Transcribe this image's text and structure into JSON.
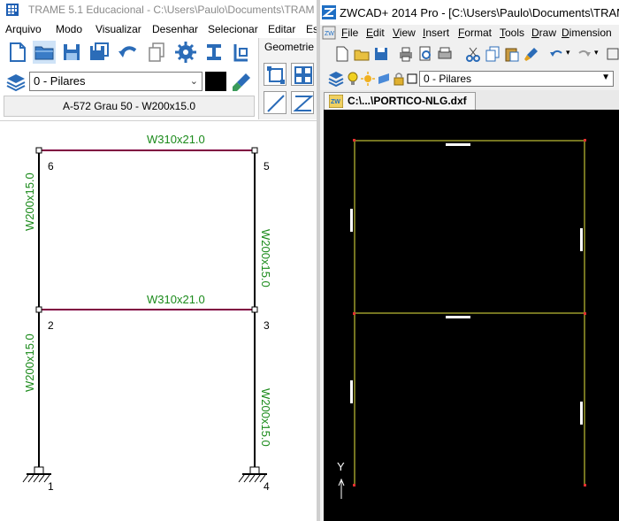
{
  "left_window": {
    "title": "TRAME 5.1  Educacional  -  C:\\Users\\Paulo\\Documents\\TRAM",
    "menu": [
      "Arquivo",
      "Modo",
      "Visualizar",
      "Desenhar",
      "Selecionar",
      "Editar",
      "Es"
    ],
    "toolbar_icons": [
      "new-file-icon",
      "open-folder-icon",
      "save-icon",
      "save-as-icon",
      "undo-icon",
      "copy-icon",
      "gear-icon",
      "i-beam-icon",
      "node-tool-icon"
    ],
    "layer_select": {
      "value": "0 - Pilares"
    },
    "layer_color": "#000000",
    "profile_label": "A-572 Grau 50 - W200x15.0",
    "geometry_panel": {
      "label": "Geometrie"
    },
    "frame": {
      "beam_top_label": "W310x21.0",
      "beam_mid_label": "W310x21.0",
      "col_left_top_label": "W200x15.0",
      "col_left_bot_label": "W200x15.0",
      "col_right_top_label": "W200x15.0",
      "col_right_bot_label": "W200x15.0",
      "nodes": {
        "n1": "1",
        "n2": "2",
        "n3": "3",
        "n4": "4",
        "n5": "5",
        "n6": "6"
      },
      "beam_color": "#800040",
      "column_color": "#000000",
      "label_color": "#1a8a1a"
    }
  },
  "right_window": {
    "title": "ZWCAD+ 2014 Pro - [C:\\Users\\Paulo\\Documents\\TRAM",
    "menu": [
      {
        "u": "F",
        "rest": "ile"
      },
      {
        "u": "E",
        "rest": "dit"
      },
      {
        "u": "V",
        "rest": "iew"
      },
      {
        "u": "I",
        "rest": "nsert"
      },
      {
        "u": "F",
        "rest": "ormat"
      },
      {
        "u": "T",
        "rest": "ools"
      },
      {
        "u": "D",
        "rest": "raw"
      },
      {
        "u": "D",
        "rest": "imension"
      }
    ],
    "layer_select": {
      "value": "0 - Pilares"
    },
    "doc_tab": "C:\\...\\PORTICO-NLG.dxf",
    "axis_label": "Y",
    "frame_color": "#e8e840",
    "canvas_bg": "#000000"
  }
}
